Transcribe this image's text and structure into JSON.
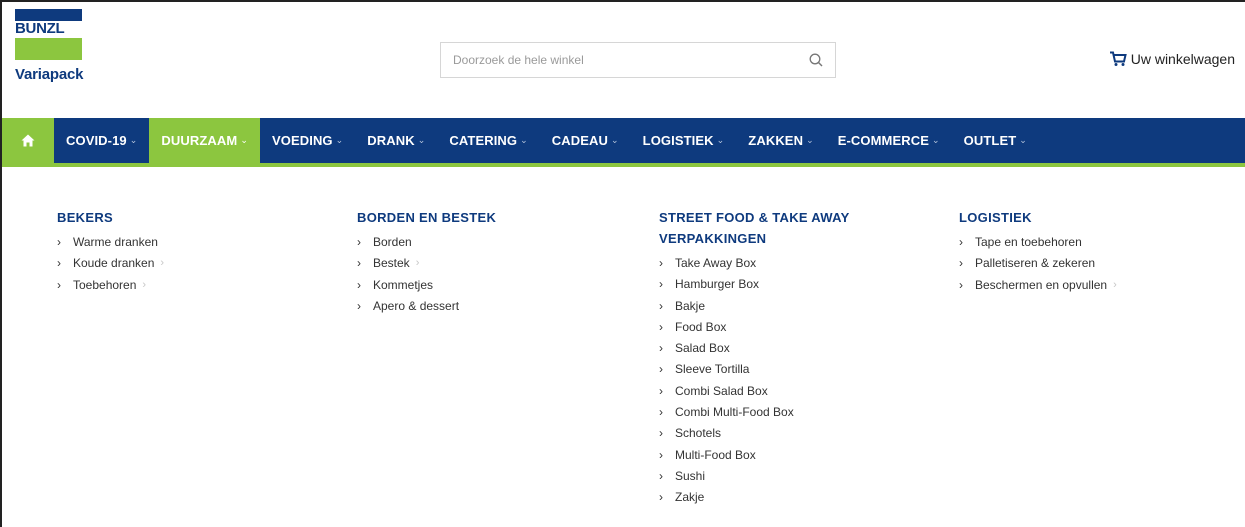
{
  "brand": {
    "top": "BUNZL",
    "bottom": "Variapack",
    "colors": {
      "blue": "#0e3a7e",
      "green": "#8cc63f"
    }
  },
  "search": {
    "placeholder": "Doorzoek de hele winkel",
    "value": ""
  },
  "cart": {
    "label": "Uw winkelwagen"
  },
  "nav": {
    "home_icon": "home-icon",
    "items": [
      {
        "label": "COVID-19",
        "active": false
      },
      {
        "label": "DUURZAAM",
        "active": true
      },
      {
        "label": "VOEDING",
        "active": false
      },
      {
        "label": "DRANK",
        "active": false
      },
      {
        "label": "CATERING",
        "active": false
      },
      {
        "label": "CADEAU",
        "active": false
      },
      {
        "label": "LOGISTIEK",
        "active": false
      },
      {
        "label": "ZAKKEN",
        "active": false
      },
      {
        "label": "E-COMMERCE",
        "active": false
      },
      {
        "label": "OUTLET",
        "active": false
      }
    ]
  },
  "menu": {
    "columns": [
      {
        "title": "BEKERS",
        "items": [
          {
            "label": "Warme dranken",
            "has_sub": false
          },
          {
            "label": "Koude dranken",
            "has_sub": true
          },
          {
            "label": "Toebehoren",
            "has_sub": true
          }
        ]
      },
      {
        "title": "BORDEN EN BESTEK",
        "items": [
          {
            "label": "Borden",
            "has_sub": false
          },
          {
            "label": "Bestek",
            "has_sub": true
          },
          {
            "label": "Kommetjes",
            "has_sub": false
          },
          {
            "label": "Apero & dessert",
            "has_sub": false
          }
        ]
      },
      {
        "title_line1": "STREET FOOD & TAKE AWAY",
        "title_line2": "VERPAKKINGEN",
        "items": [
          {
            "label": "Take Away Box",
            "has_sub": false
          },
          {
            "label": "Hamburger Box",
            "has_sub": false
          },
          {
            "label": "Bakje",
            "has_sub": false
          },
          {
            "label": "Food Box",
            "has_sub": false
          },
          {
            "label": "Salad Box",
            "has_sub": false
          },
          {
            "label": "Sleeve Tortilla",
            "has_sub": false
          },
          {
            "label": "Combi Salad Box",
            "has_sub": false
          },
          {
            "label": "Combi Multi-Food Box",
            "has_sub": false
          },
          {
            "label": "Schotels",
            "has_sub": false
          },
          {
            "label": "Multi-Food Box",
            "has_sub": false
          },
          {
            "label": "Sushi",
            "has_sub": false
          },
          {
            "label": "Zakje",
            "has_sub": false
          }
        ]
      },
      {
        "title": "LOGISTIEK",
        "items": [
          {
            "label": "Tape en toebehoren",
            "has_sub": false
          },
          {
            "label": "Palletiseren & zekeren",
            "has_sub": false
          },
          {
            "label": "Beschermen en opvullen",
            "has_sub": true
          }
        ]
      }
    ]
  }
}
